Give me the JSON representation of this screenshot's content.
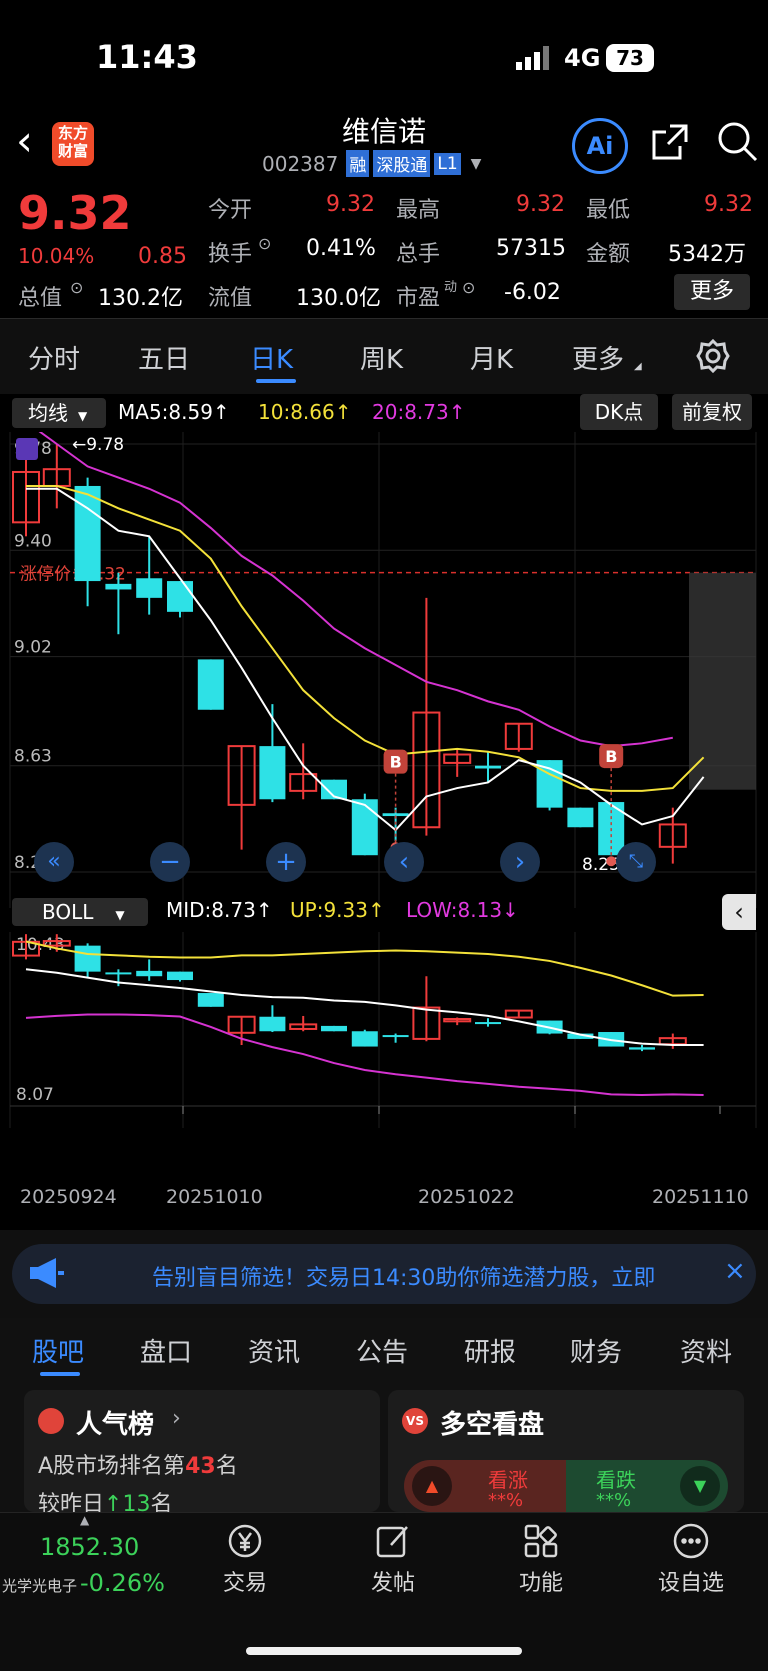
{
  "status_bar": {
    "time": "11:43",
    "network": "4G",
    "battery": "73"
  },
  "header": {
    "title": "维信诺",
    "code": "002387",
    "tags": [
      "融",
      "深股通",
      "L1"
    ],
    "logo_line1": "东方",
    "logo_line2": "财富",
    "ai_label": "Ai"
  },
  "quote": {
    "price": "9.32",
    "pct": "10.04%",
    "chg": "0.85",
    "open_label": "今开",
    "open": "9.32",
    "high_label": "最高",
    "high": "9.32",
    "low_label": "最低",
    "low": "9.32",
    "turnover_label": "换手",
    "turnover": "0.41%",
    "volume_label": "总手",
    "volume": "57315",
    "amount_label": "金额",
    "amount": "5342万",
    "mcap_label": "总值",
    "mcap": "130.2亿",
    "float_label": "流值",
    "float": "130.0亿",
    "pe_label": "市盈",
    "pe_sup": "动",
    "pe": "-6.02",
    "more": "更多"
  },
  "period_tabs": [
    "分时",
    "五日",
    "日K",
    "周K",
    "月K",
    "更多"
  ],
  "active_tab": "日K",
  "indicator_bar": {
    "selector": "均线",
    "ma5": "MA5:8.59↑",
    "ma10": "10:8.66↑",
    "ma20": "20:8.73↑",
    "dk": "DK点",
    "adjust": "前复权"
  },
  "main_chart": {
    "y_labels": [
      "9.78",
      "9.40",
      "9.02",
      "8.63",
      "8.25"
    ],
    "max_marker": "←9.78",
    "min_marker": "8.25→",
    "limit_label": "涨停价：9.32",
    "signal": "B"
  },
  "boll_bar": {
    "selector": "BOLL",
    "mid": "MID:8.73↑",
    "up": "UP:9.33↑",
    "low": "LOW:8.13↓",
    "y_top": "10.43",
    "y_bottom": "8.07"
  },
  "x_labels": [
    "20250924",
    "20251010",
    "20251022",
    "20251110"
  ],
  "banner": {
    "text": "告别盲目筛选！交易日14:30助你筛选潜力股，立即"
  },
  "bottom_tabs": [
    "股吧",
    "盘口",
    "资讯",
    "公告",
    "研报",
    "财务",
    "资料"
  ],
  "active_bottom_tab": "股吧",
  "card_left": {
    "title": "人气榜",
    "line1_prefix": "A股市场排名第",
    "rank": "43",
    "line1_suffix": "名",
    "line2_prefix": "较昨日",
    "line2_value": "13",
    "line2_suffix": "名"
  },
  "card_right": {
    "title": "多空看盘",
    "bull": "看涨",
    "bear": "看跌",
    "masked": "**%"
  },
  "bottom_nav": {
    "index_value": "1852.30",
    "index_name": "光学光电子",
    "index_pct": "-0.26%",
    "items": [
      "交易",
      "发帖",
      "功能",
      "设自选"
    ]
  },
  "chart_data": {
    "type": "candlestick",
    "ylim": [
      8.25,
      9.78
    ],
    "limit_price": 9.32,
    "candles": [
      {
        "o": 9.5,
        "h": 9.78,
        "l": 9.45,
        "c": 9.68,
        "up": true
      },
      {
        "o": 9.63,
        "h": 9.78,
        "l": 9.55,
        "c": 9.69,
        "up": true
      },
      {
        "o": 9.63,
        "h": 9.66,
        "l": 9.2,
        "c": 9.29,
        "up": false
      },
      {
        "o": 9.28,
        "h": 9.32,
        "l": 9.1,
        "c": 9.26,
        "up": false
      },
      {
        "o": 9.3,
        "h": 9.45,
        "l": 9.17,
        "c": 9.23,
        "up": false
      },
      {
        "o": 9.29,
        "h": 9.29,
        "l": 9.16,
        "c": 9.18,
        "up": false
      },
      {
        "o": 9.01,
        "h": 9.01,
        "l": 8.83,
        "c": 8.83,
        "up": false
      },
      {
        "o": 8.7,
        "h": 8.7,
        "l": 8.33,
        "c": 8.49,
        "up": true
      },
      {
        "o": 8.7,
        "h": 8.85,
        "l": 8.5,
        "c": 8.51,
        "up": false
      },
      {
        "o": 8.6,
        "h": 8.71,
        "l": 8.51,
        "c": 8.54,
        "up": true
      },
      {
        "o": 8.58,
        "h": 8.58,
        "l": 8.51,
        "c": 8.51,
        "up": false
      },
      {
        "o": 8.51,
        "h": 8.53,
        "l": 8.31,
        "c": 8.31,
        "up": false
      },
      {
        "o": 8.45,
        "h": 8.48,
        "l": 8.36,
        "c": 8.46,
        "up": false
      },
      {
        "o": 8.41,
        "h": 9.23,
        "l": 8.38,
        "c": 8.82,
        "up": true
      },
      {
        "o": 8.64,
        "h": 8.69,
        "l": 8.59,
        "c": 8.67,
        "up": true
      },
      {
        "o": 8.63,
        "h": 8.68,
        "l": 8.57,
        "c": 8.62,
        "up": false
      },
      {
        "o": 8.69,
        "h": 8.78,
        "l": 8.68,
        "c": 8.78,
        "up": true
      },
      {
        "o": 8.65,
        "h": 8.65,
        "l": 8.47,
        "c": 8.48,
        "up": false
      },
      {
        "o": 8.48,
        "h": 8.48,
        "l": 8.41,
        "c": 8.41,
        "up": false
      },
      {
        "o": 8.5,
        "h": 8.5,
        "l": 8.31,
        "c": 8.31,
        "up": false
      },
      {
        "o": 8.3,
        "h": 8.33,
        "l": 8.25,
        "c": 8.27,
        "up": false
      },
      {
        "o": 8.34,
        "h": 8.48,
        "l": 8.28,
        "c": 8.42,
        "up": true
      }
    ],
    "ma5": [
      9.62,
      9.62,
      9.55,
      9.47,
      9.45,
      9.3,
      9.15,
      8.98,
      8.8,
      8.63,
      8.52,
      8.49,
      8.4,
      8.52,
      8.55,
      8.57,
      8.65,
      8.62,
      8.57,
      8.49,
      8.42,
      8.45,
      8.59
    ],
    "ma10": [
      9.63,
      9.63,
      9.6,
      9.55,
      9.51,
      9.47,
      9.37,
      9.2,
      9.05,
      8.9,
      8.8,
      8.72,
      8.67,
      8.68,
      8.69,
      8.68,
      8.66,
      8.6,
      8.55,
      8.54,
      8.54,
      8.55,
      8.66
    ],
    "ma20": [
      9.86,
      9.78,
      9.7,
      9.66,
      9.62,
      9.57,
      9.48,
      9.38,
      9.31,
      9.22,
      9.12,
      9.05,
      8.99,
      8.93,
      8.9,
      8.86,
      8.83,
      8.77,
      8.72,
      8.7,
      8.71,
      8.73
    ],
    "boll": {
      "ylim": [
        8.07,
        10.43
      ],
      "up": [
        10.38,
        10.28,
        10.2,
        10.18,
        10.16,
        10.15,
        10.15,
        10.18,
        10.18,
        10.2,
        10.22,
        10.24,
        10.25,
        10.24,
        10.22,
        10.2,
        10.16,
        10.1,
        10.0,
        9.89,
        9.75,
        9.6,
        9.61
      ],
      "mid": [
        9.98,
        9.93,
        9.86,
        9.79,
        9.75,
        9.71,
        9.66,
        9.61,
        9.58,
        9.57,
        9.53,
        9.51,
        9.46,
        9.4,
        9.36,
        9.31,
        9.23,
        9.14,
        9.04,
        8.96,
        8.91,
        8.89,
        8.89
      ],
      "low": [
        9.28,
        9.31,
        9.33,
        9.33,
        9.32,
        9.3,
        9.15,
        8.98,
        8.86,
        8.76,
        8.63,
        8.53,
        8.47,
        8.42,
        8.37,
        8.33,
        8.29,
        8.26,
        8.23,
        8.18,
        8.17,
        8.18,
        8.17
      ]
    }
  }
}
